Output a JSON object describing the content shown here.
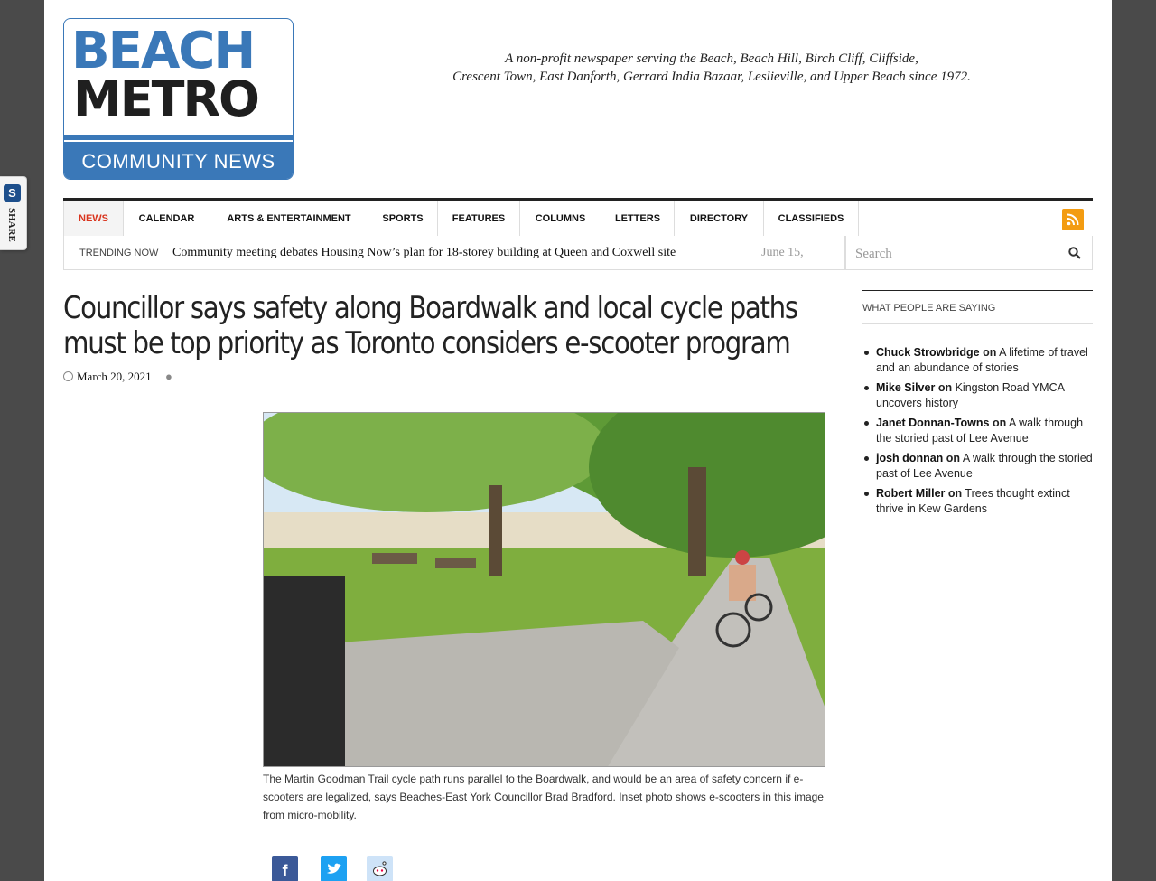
{
  "share": {
    "label": "SHARE"
  },
  "logo": {
    "line1": "BEACH",
    "line2": "METRO",
    "line3": "COMMUNITY NEWS"
  },
  "tagline": {
    "line1": "A non-profit newspaper serving the Beach, Beach Hill, Birch Cliff, Cliffside,",
    "line2": "Crescent Town, East Danforth, Gerrard India Bazaar, Leslieville, and Upper Beach since 1972."
  },
  "nav": {
    "items": [
      "NEWS",
      "CALENDAR",
      "ARTS & ENTERTAINMENT",
      "SPORTS",
      "FEATURES",
      "COLUMNS",
      "LETTERS",
      "DIRECTORY",
      "CLASSIFIEDS"
    ],
    "active": "NEWS"
  },
  "trending": {
    "label": "TRENDING NOW",
    "headline": "Community meeting debates Housing Now’s plan for 18-storey building at Queen and Coxwell site",
    "date": "June 15,"
  },
  "search": {
    "placeholder": "Search"
  },
  "article": {
    "title": "Councillor says safety along Boardwalk and local cycle paths must be top priority as Toronto considers e-scooter program",
    "date": "March 20, 2021",
    "caption": "The Martin Goodman Trail cycle path runs parallel to the Boardwalk, and would be an area of safety concern if e-scooters are legalized, says Beaches-East York Councillor Brad Bradford. Inset photo shows e-scooters in this image from micro-mobility."
  },
  "sidebar": {
    "title": "WHAT PEOPLE ARE SAYING",
    "comments": [
      {
        "author": "Chuck Strowbridge",
        "on": "on",
        "post": "A lifetime of travel and an abundance of stories"
      },
      {
        "author": "Mike Silver",
        "on": "on",
        "post": "Kingston Road YMCA uncovers history"
      },
      {
        "author": "Janet Donnan-Towns",
        "on": "on",
        "post": "A walk through the storied past of Lee Avenue"
      },
      {
        "author": "josh donnan",
        "on": "on",
        "post": "A walk through the storied past of Lee Avenue"
      },
      {
        "author": "Robert Miller",
        "on": "on",
        "post": "Trees thought extinct thrive in Kew Gardens"
      }
    ]
  },
  "colors": {
    "brand_blue": "#3a78b8",
    "accent_red": "#d9341d",
    "rss_orange": "#f39c12"
  }
}
